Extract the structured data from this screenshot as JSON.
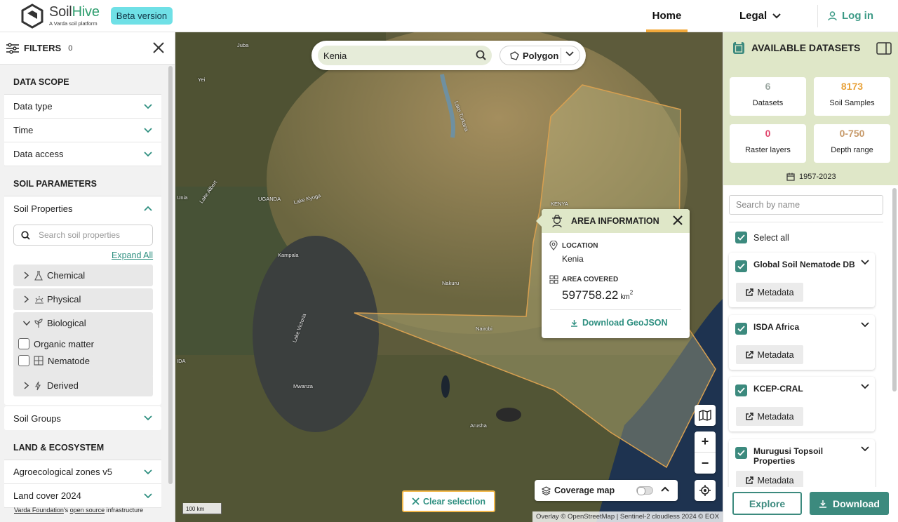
{
  "header": {
    "logo_name_part1": "Soil",
    "logo_name_part2": "Hive",
    "logo_sub": "A Varda soil platform",
    "beta": "Beta version",
    "nav_home": "Home",
    "nav_legal": "Legal",
    "nav_login": "Log in"
  },
  "filters": {
    "title": "FILTERS",
    "count": "0",
    "data_scope": {
      "title": "DATA SCOPE",
      "items": [
        "Data type",
        "Time",
        "Data access"
      ]
    },
    "soil_parameters": {
      "title": "SOIL PARAMETERS",
      "soil_properties": "Soil Properties",
      "search_placeholder": "Search soil properties",
      "expand_all": "Expand All",
      "categories": [
        "Chemical",
        "Physical",
        "Biological",
        "Derived"
      ],
      "biological_items": [
        "Organic matter",
        "Nematode"
      ],
      "soil_groups": "Soil Groups"
    },
    "land_ecosystem": {
      "title": "LAND & ECOSYSTEM",
      "items": [
        "Agroecological zones v5",
        "Land cover 2024"
      ]
    },
    "footer": {
      "org": "Varda Foundation",
      "mid": "'s ",
      "link": "open source",
      "tail": " infrastructure"
    }
  },
  "map": {
    "search_value": "Kenia",
    "polygon_label": "Polygon",
    "labels": [
      "Juba",
      "Yei",
      "Lake Turkana",
      "UGANDA",
      "Lake Kyoga",
      "Lake Albert",
      "KENYA",
      "Kampala",
      "Lake Victoria",
      "Nakuru",
      "Nairobi",
      "Mwanza",
      "Arusha",
      "Unia",
      "IDA"
    ],
    "area_info": {
      "title": "AREA INFORMATION",
      "location_label": "LOCATION",
      "location_value": "Kenia",
      "area_label": "AREA COVERED",
      "area_value": "597758.22",
      "area_unit": "km",
      "area_unit_sup": "2",
      "download": "Download GeoJSON"
    },
    "coverage_label": "Coverage map",
    "clear_selection": "Clear selection",
    "scale": "100 km",
    "attribution": "Overlay © OpenStreetMap | Sentinel-2 cloudless 2024 © EOX"
  },
  "datasets": {
    "title": "AVAILABLE DATASETS",
    "stats": [
      {
        "value": "6",
        "label": "Datasets",
        "color": "#9aa6a0"
      },
      {
        "value": "8173",
        "label": "Soil Samples",
        "color": "#e8a23a"
      },
      {
        "value": "0",
        "label": "Raster layers",
        "color": "#e0436b"
      },
      {
        "value": "0-750",
        "label": "Depth range",
        "color": "#c79a6a"
      }
    ],
    "date_range": "1957-2023",
    "search_placeholder": "Search by name",
    "select_all": "Select all",
    "items": [
      {
        "name": "Global Soil Nematode DB",
        "meta": "Metadata"
      },
      {
        "name": "ISDA Africa",
        "meta": "Metadata"
      },
      {
        "name": "KCEP-CRAL",
        "meta": "Metadata"
      },
      {
        "name": "Murugusi Topsoil Properties",
        "meta": "Metadata"
      }
    ],
    "explore": "Explore",
    "download": "Download"
  },
  "colors": {
    "accent": "#3c8a7e",
    "panel_green": "#dfe7c8",
    "highlight": "#f2a93b"
  }
}
